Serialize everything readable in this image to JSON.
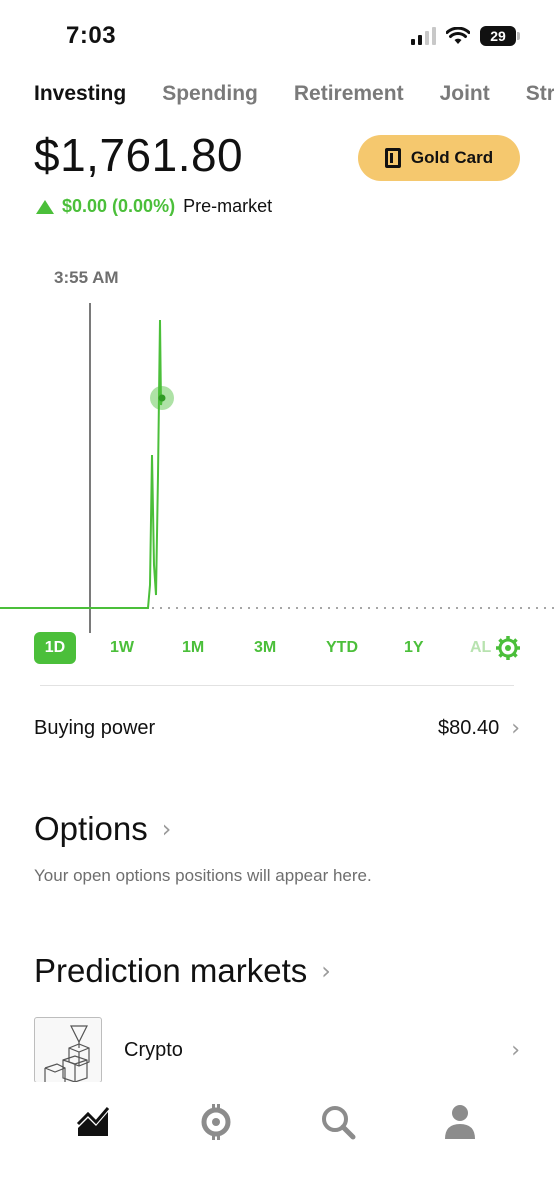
{
  "status_bar": {
    "time": "7:03",
    "battery": "29"
  },
  "tabs": [
    {
      "label": "Investing",
      "active": true
    },
    {
      "label": "Spending",
      "active": false
    },
    {
      "label": "Retirement",
      "active": false
    },
    {
      "label": "Joint",
      "active": false
    },
    {
      "label": "Stra",
      "active": false
    }
  ],
  "portfolio": {
    "balance": "$1,761.80",
    "change": "$0.00 (0.00%)",
    "change_label": "Pre-market",
    "gold_card_label": "Gold Card",
    "chart_time": "3:55 AM"
  },
  "ranges": [
    {
      "label": "1D",
      "active": true
    },
    {
      "label": "1W",
      "active": false
    },
    {
      "label": "1M",
      "active": false
    },
    {
      "label": "3M",
      "active": false
    },
    {
      "label": "YTD",
      "active": false
    },
    {
      "label": "1Y",
      "active": false
    },
    {
      "label": "AL",
      "active": false
    }
  ],
  "buying_power": {
    "label": "Buying power",
    "value": "$80.40"
  },
  "options": {
    "title": "Options",
    "note": "Your open options positions will appear here."
  },
  "prediction_markets": {
    "title": "Prediction markets",
    "first_item": "Crypto"
  },
  "colors": {
    "accent_green": "#4bbf3a",
    "gold": "#f5c86e",
    "muted_text": "#7a7a7a"
  },
  "icons": {
    "nav": [
      "chart-trend-icon",
      "crypto-coin-icon",
      "search-icon",
      "account-icon"
    ]
  }
}
